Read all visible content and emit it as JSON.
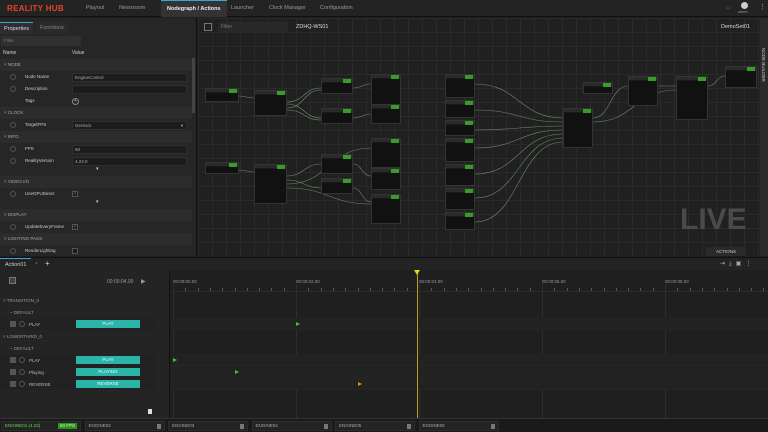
{
  "app": {
    "title": "REALITY HUB",
    "tabs": [
      "Playout",
      "Newsroom",
      "Nodegraph / Actions",
      "Launcher",
      "Clock Manager",
      "Configuration"
    ],
    "active_tab": "Nodegraph / Actions",
    "user_label": "admin"
  },
  "properties": {
    "tabs": [
      "Properties",
      "Functions"
    ],
    "filter_placeholder": "Filter",
    "col_name": "Name",
    "col_value": "Value",
    "rows": [
      {
        "type": "section",
        "label": "NODE"
      },
      {
        "type": "text",
        "label": "Node Name",
        "value": "EngineControl"
      },
      {
        "type": "text",
        "label": "Description",
        "value": ""
      },
      {
        "type": "tags",
        "label": "Tags"
      },
      {
        "type": "section",
        "label": "CLOCK"
      },
      {
        "type": "select",
        "label": "TargetFPS",
        "value": "Genlock"
      },
      {
        "type": "section",
        "label": "INFO"
      },
      {
        "type": "text",
        "label": "FPS",
        "value": "50"
      },
      {
        "type": "text",
        "label": "RealityVersion",
        "value": "4.23.0"
      },
      {
        "type": "more"
      },
      {
        "type": "section",
        "label": "VIDEO I/O"
      },
      {
        "type": "check",
        "label": "UseGPUDirect",
        "checked": true
      },
      {
        "type": "more"
      },
      {
        "type": "section",
        "label": "DISPLAY"
      },
      {
        "type": "check",
        "label": "UpdateEveryFrame",
        "checked": true
      },
      {
        "type": "section",
        "label": "LIGHTING PASS"
      },
      {
        "type": "check",
        "label": "RenderLighting",
        "checked": false
      }
    ]
  },
  "graph": {
    "filter_placeholder": "Filter",
    "engine": "ZDHQ-WS01",
    "set_name": "DemoSet01",
    "watermark": "LIVE",
    "actions_label": "ACTIONS",
    "side_tab": "NODE BUILDER",
    "accent": "#3a9a2a"
  },
  "timeline": {
    "tab": "Action01",
    "duration": "00:00:04.00",
    "ticks": [
      "00:00:00.00",
      "00:00:02.00",
      "00:00:04.00",
      "00:00:06.00",
      "00:00:08.00"
    ],
    "playhead": "00:00:04.00",
    "rows": [
      {
        "type": "group",
        "label": "TRANSITION_0"
      },
      {
        "type": "sub",
        "label": "DEFAULT"
      },
      {
        "type": "track",
        "label": "PLAY",
        "button": "PLAY",
        "key_time_s": 2.0,
        "color": "#3bc43b"
      },
      {
        "type": "group",
        "label": "LOWERTHIRD_0"
      },
      {
        "type": "sub",
        "label": "DEFAULT"
      },
      {
        "type": "track",
        "label": "PLAY",
        "button": "PLAY",
        "key_time_s": 0.0,
        "color": "#3bc43b"
      },
      {
        "type": "track",
        "label": "Playing",
        "button": "PLAYING",
        "key_time_s": 1.0,
        "color": "#3bc43b"
      },
      {
        "type": "track",
        "label": "REVERSE",
        "button": "REVERSE",
        "key_time_s": 3.0,
        "color": "#e58a1f"
      }
    ]
  },
  "status": {
    "engines": [
      {
        "label": "ENGINE01 (4.23)",
        "badge": "60 FPS",
        "active": true
      },
      {
        "label": "ENGINE02"
      },
      {
        "label": "ENGINE03"
      },
      {
        "label": "ENGINE04"
      },
      {
        "label": "ENGINE05"
      },
      {
        "label": "ENGINE06"
      }
    ]
  }
}
